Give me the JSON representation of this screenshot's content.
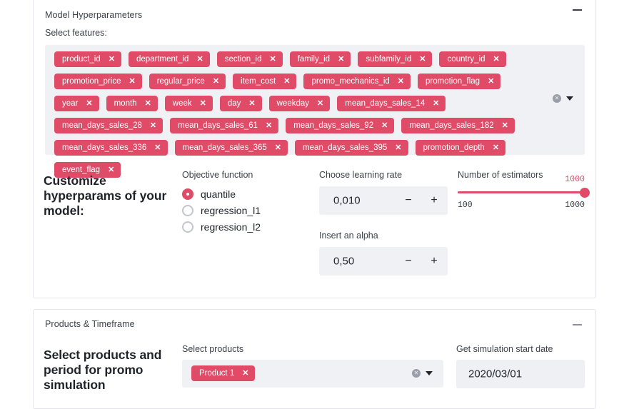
{
  "panels": {
    "model": {
      "title": "Model Hyperparameters",
      "collapse_icon": "minus-icon",
      "features_label": "Select features:",
      "selected_features": [
        "product_id",
        "department_id",
        "section_id",
        "family_id",
        "subfamily_id",
        "country_id",
        "promotion_price",
        "regular_price",
        "item_cost",
        "promo_mechanics_id",
        "promotion_flag",
        "year",
        "month",
        "week",
        "day",
        "weekday",
        "mean_days_sales_14",
        "mean_days_sales_28",
        "mean_days_sales_61",
        "mean_days_sales_92",
        "mean_days_sales_182",
        "mean_days_sales_336",
        "mean_days_sales_365",
        "mean_days_sales_395",
        "promotion_depth",
        "event_flag"
      ],
      "chip_remove_glyph": "✕",
      "clear_glyph": "✕",
      "heading": "Customize hyperparams of your model:",
      "objective": {
        "label": "Objective function",
        "options": [
          "quantile",
          "regression_l1",
          "regression_l2"
        ],
        "selected": "quantile"
      },
      "learning_rate": {
        "label": "Choose learning rate",
        "value": "0,010",
        "minus_label": "−",
        "plus_label": "+"
      },
      "alpha": {
        "label": "Insert an alpha",
        "value": "0,50",
        "minus_label": "−",
        "plus_label": "+"
      },
      "estimators": {
        "label": "Number of estimators",
        "value": "1000",
        "min": "100",
        "max": "1000",
        "percent": 100
      }
    },
    "products": {
      "title": "Products & Timeframe",
      "collapse_icon": "minus-icon",
      "heading": "Select products and period for promo simulation",
      "select_products": {
        "label": "Select products",
        "chips": [
          "Product 1"
        ],
        "chip_remove_glyph": "✕",
        "clear_glyph": "✕"
      },
      "start_date": {
        "label": "Get simulation start date",
        "value": "2020/03/01"
      }
    }
  },
  "colors": {
    "accent": "#e04b68",
    "field_bg": "#f0f1f5",
    "panel_border": "#e4e6eb"
  }
}
